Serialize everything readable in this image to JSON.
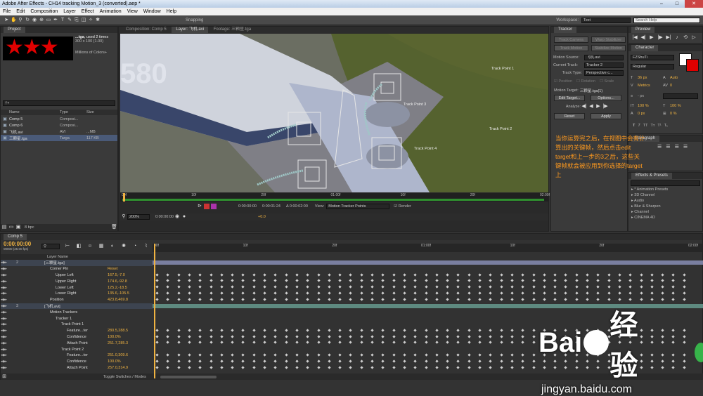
{
  "app": {
    "title": "Adobe After Effects - CH14 tracking Motion_3 (converted).aep *"
  },
  "menu": [
    "File",
    "Edit",
    "Composition",
    "Layer",
    "Effect",
    "Animation",
    "View",
    "Window",
    "Help"
  ],
  "toolbar": {
    "snapping": "Snapping",
    "workspace_label": "Workspace:",
    "workspace_value": "Text",
    "search_placeholder": "Search Help"
  },
  "project": {
    "title": "Project",
    "thumb_name": "...tga",
    "thumb_info1": ", used 2 times",
    "thumb_info2": "300 x 100 (1.00)",
    "thumb_info3": "Millions of Colors+",
    "columns": [
      "Name",
      "Type",
      "Size"
    ],
    "items": [
      {
        "name": "Comp 5",
        "type": "Composi...",
        "size": ""
      },
      {
        "name": "Comp 6",
        "type": "Composi...",
        "size": ""
      },
      {
        "name": "飞机.avi",
        "type": "AVI",
        "size": "...MB"
      },
      {
        "name": "三颗星.tga",
        "type": "Targa",
        "size": "117 KB"
      }
    ],
    "bpc": "8 bpc"
  },
  "viewer": {
    "tabs": [
      "Composition: Comp 5",
      "Layer: 飞机.avi",
      "Footage: 三颗星.tga"
    ],
    "track_points": [
      "Track Point 1",
      "Track Point 2",
      "Track Point 3",
      "Track Point 4"
    ],
    "ruler": [
      "00f",
      "10f",
      "20f",
      "01:00f",
      "10f",
      "20f",
      "02:00f"
    ],
    "time_current": "0:00:00:00",
    "time_end": "0:00:01:24",
    "time_delta": "Δ 0:00:02:00",
    "view_label": "View:",
    "view_value": "Motion Tracker Points",
    "render_label": "Render",
    "zoom": "200%",
    "time2": "0:00:00:00",
    "plus": "+0.0"
  },
  "tracker": {
    "title": "Tracker",
    "buttons_row1": [
      "Track Camera",
      "Warp Stabilizer"
    ],
    "buttons_row2": [
      "Track Motion",
      "Stabilize Motion"
    ],
    "motion_source_label": "Motion Source:",
    "motion_source": "飞机.avi",
    "current_track_label": "Current Track:",
    "current_track": "Tracker 2",
    "track_type_label": "Track Type:",
    "track_type": "Perspective c...",
    "checks": [
      "Position",
      "Rotation",
      "Scale"
    ],
    "motion_target_label": "Motion Target:",
    "motion_target": "三颗星.tga(1)",
    "edit_target": "Edit Target...",
    "options": "Options...",
    "analyze_label": "Analyze:",
    "reset": "Reset",
    "apply": "Apply"
  },
  "annotation": {
    "text": "当你运算完之后，在视图中会有计算出的关键帧，然后点击edit target和上一步的3之后，这些关键帧就会被应用到你选择的target上"
  },
  "preview": {
    "title": "Preview"
  },
  "character": {
    "title": "Character",
    "font": "FZShuTi",
    "style": "Regular",
    "size": "36 px",
    "leading": "Auto",
    "kerning": "Metrics",
    "tracking": "0",
    "stroke": "- px",
    "vscale": "100 %",
    "hscale": "100 %",
    "baseline": "0 px",
    "tsume": "0 %"
  },
  "paragraph": {
    "title": "Paragraph"
  },
  "effects": {
    "title": "Effects & Presets",
    "items": [
      "* Animation Presets",
      "3D Channel",
      "Audio",
      "Blur & Sharpen",
      "Channel",
      "CINEMA 4D"
    ]
  },
  "timeline": {
    "tab": "Comp 5",
    "timecode": "0:00:00:00",
    "fps": "00000 (25.00 fps)",
    "layer_header": "Layer Name",
    "ruler": [
      "00f",
      "10f",
      "20f",
      "01:00f",
      "10f",
      "20f",
      "02:00f"
    ],
    "toggle": "Toggle Switches / Modes",
    "rows": [
      {
        "indent": 0,
        "num": "2",
        "name": "[三颗星.tga]",
        "value": ""
      },
      {
        "indent": 1,
        "num": "",
        "name": "Corner Pin",
        "value": "Reset"
      },
      {
        "indent": 2,
        "num": "",
        "name": "Upper Left",
        "value": "167.5,-7.0"
      },
      {
        "indent": 2,
        "num": "",
        "name": "Upper Right",
        "value": "174.6,-92.8"
      },
      {
        "indent": 2,
        "num": "",
        "name": "Lower Left",
        "value": "125.2,-18.5"
      },
      {
        "indent": 2,
        "num": "",
        "name": "Lower Right",
        "value": "135.6,-105.5"
      },
      {
        "indent": 1,
        "num": "",
        "name": "Position",
        "value": "423.8,469.8"
      },
      {
        "indent": 0,
        "num": "3",
        "name": "[飞机.avi]",
        "value": ""
      },
      {
        "indent": 1,
        "num": "",
        "name": "Motion Trackers",
        "value": ""
      },
      {
        "indent": 2,
        "num": "",
        "name": "Tracker 1",
        "value": ""
      },
      {
        "indent": 3,
        "num": "",
        "name": "Track Point 1",
        "value": ""
      },
      {
        "indent": 4,
        "num": "",
        "name": "Feature...ter",
        "value": "280.5,288.5"
      },
      {
        "indent": 4,
        "num": "",
        "name": "Confidence",
        "value": "100.0%"
      },
      {
        "indent": 4,
        "num": "",
        "name": "Attach Point",
        "value": "251.7,285.3"
      },
      {
        "indent": 3,
        "num": "",
        "name": "Track Point 2",
        "value": ""
      },
      {
        "indent": 4,
        "num": "",
        "name": "Feature...ter",
        "value": "251.0,309.6"
      },
      {
        "indent": 4,
        "num": "",
        "name": "Confidence",
        "value": "100.0%"
      },
      {
        "indent": 4,
        "num": "",
        "name": "Attach Point",
        "value": "257.0,314.9"
      }
    ]
  },
  "watermark": {
    "brand": "Bai",
    "brand2": "经验",
    "url": "jingyan.baidu.com"
  },
  "colors": {
    "accent": "#f0b341",
    "annotation": "#ff9a1f",
    "star": "#e00000"
  }
}
